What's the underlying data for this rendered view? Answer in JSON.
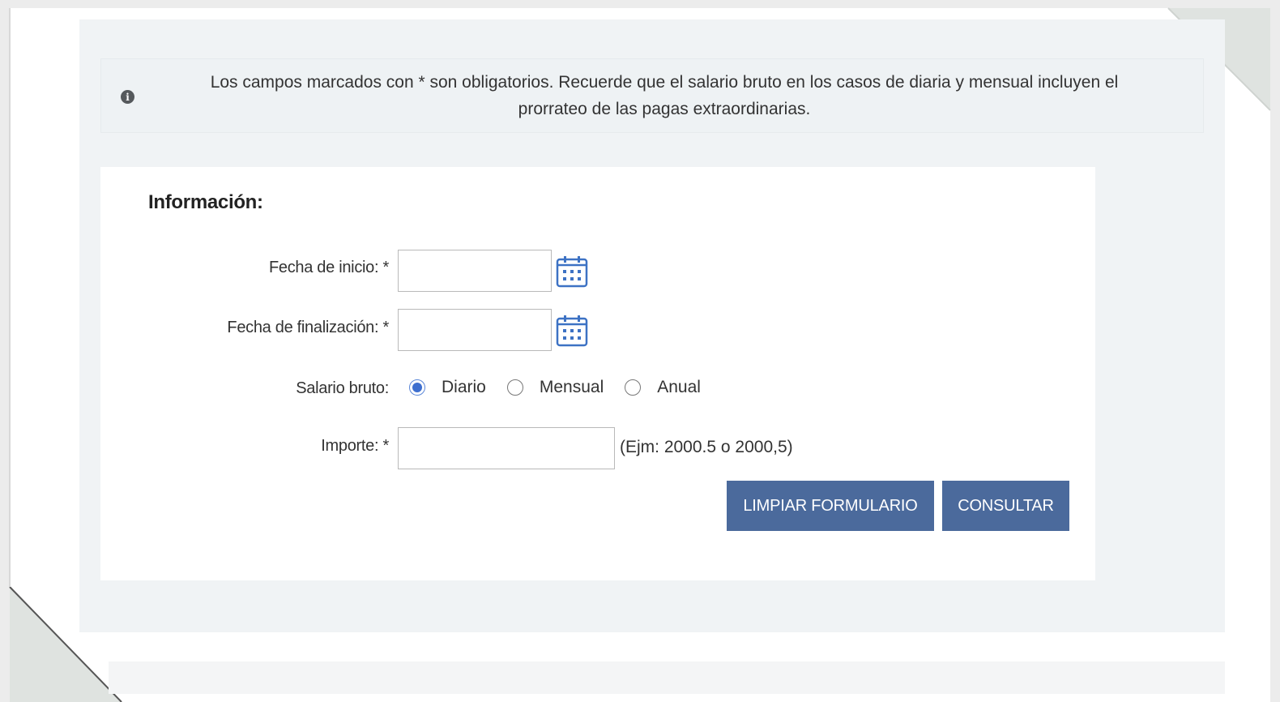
{
  "notice": {
    "icon": "info-icon",
    "text": "Los campos marcados con * son obligatorios. Recuerde que el salario bruto en los casos de diaria y mensual incluyen el prorrateo de las pagas extraordinarias."
  },
  "form": {
    "title": "Información:",
    "start_date": {
      "label": "Fecha de inicio: *",
      "value": "",
      "calendar_icon": "calendar-icon"
    },
    "end_date": {
      "label": "Fecha de finalización: *",
      "value": "",
      "calendar_icon": "calendar-icon"
    },
    "salary": {
      "label": "Salario bruto:",
      "options": [
        {
          "label": "Diario",
          "checked": true
        },
        {
          "label": "Mensual",
          "checked": false
        },
        {
          "label": "Anual",
          "checked": false
        }
      ]
    },
    "amount": {
      "label": "Importe: *",
      "value": "",
      "hint": "(Ejm: 2000.5 o 2000,5)"
    },
    "buttons": {
      "clear": "LIMPIAR FORMULARIO",
      "submit": "CONSULTAR"
    }
  },
  "colors": {
    "button": "#4b6a9c",
    "calendar": "#3d72c4",
    "radio_checked": "#3e6fcf",
    "panel": "#f0f3f5"
  }
}
